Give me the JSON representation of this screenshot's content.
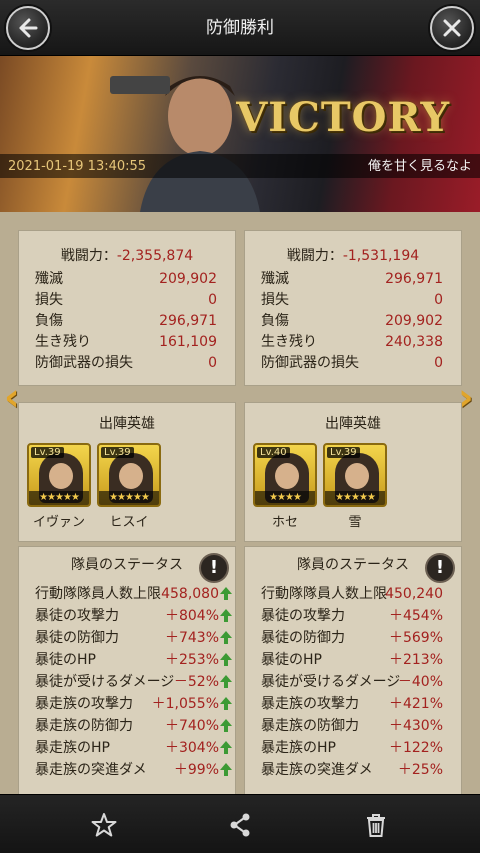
{
  "header": {
    "title": "防御勝利",
    "back_icon": "back-arrow-icon",
    "close_icon": "close-icon"
  },
  "banner": {
    "victory_text": "VICTORY",
    "date": "2021-01-19  13:40:55",
    "quote": "俺を甘く見るなよ"
  },
  "left": {
    "power_label": "戦闘力：",
    "power_value": "-2,355,874",
    "stats": [
      {
        "label": "殲滅",
        "value": "209,902"
      },
      {
        "label": "損失",
        "value": "0"
      },
      {
        "label": "負傷",
        "value": "296,971"
      },
      {
        "label": "生き残り",
        "value": "161,109"
      },
      {
        "label": "防御武器の損失",
        "value": "0"
      }
    ],
    "heroes_title": "出陣英雄",
    "heroes": [
      {
        "level": "Lv.39",
        "name": "イヴァン",
        "stars": "★★★★★"
      },
      {
        "level": "Lv.39",
        "name": "ヒスイ",
        "stars": "★★★★★"
      }
    ],
    "status_title": "隊員のステータス",
    "status": [
      {
        "label": "行動隊隊員人数上限",
        "value": "458,080"
      },
      {
        "label": "暴徒の攻撃力",
        "value": "＋804%"
      },
      {
        "label": "暴徒の防御力",
        "value": "＋743%"
      },
      {
        "label": "暴徒のHP",
        "value": "＋253%"
      },
      {
        "label": "暴徒が受けるダメージ",
        "value": "－52%"
      },
      {
        "label": "暴走族の攻撃力",
        "value": "＋1,055%"
      },
      {
        "label": "暴走族の防御力",
        "value": "＋740%"
      },
      {
        "label": "暴走族のHP",
        "value": "＋304%"
      },
      {
        "label": "暴走族の突進ダメ",
        "value": "＋99%"
      }
    ]
  },
  "right": {
    "power_label": "戦闘力：",
    "power_value": "-1,531,194",
    "stats": [
      {
        "label": "殲滅",
        "value": "296,971"
      },
      {
        "label": "損失",
        "value": "0"
      },
      {
        "label": "負傷",
        "value": "209,902"
      },
      {
        "label": "生き残り",
        "value": "240,338"
      },
      {
        "label": "防御武器の損失",
        "value": "0"
      }
    ],
    "heroes_title": "出陣英雄",
    "heroes": [
      {
        "level": "Lv.40",
        "name": "ホセ",
        "stars": "★★★★"
      },
      {
        "level": "Lv.39",
        "name": "雪",
        "stars": "★★★★★"
      }
    ],
    "status_title": "隊員のステータス",
    "status": [
      {
        "label": "行動隊隊員人数上限",
        "value": "450,240"
      },
      {
        "label": "暴徒の攻撃力",
        "value": "＋454%"
      },
      {
        "label": "暴徒の防御力",
        "value": "＋569%"
      },
      {
        "label": "暴徒のHP",
        "value": "＋213%"
      },
      {
        "label": "暴徒が受けるダメージ",
        "value": "－40%"
      },
      {
        "label": "暴走族の攻撃力",
        "value": "＋421%"
      },
      {
        "label": "暴走族の防御力",
        "value": "＋430%"
      },
      {
        "label": "暴走族のHP",
        "value": "＋122%"
      },
      {
        "label": "暴走族の突進ダメ",
        "value": "＋25%"
      }
    ]
  },
  "bottom": {
    "icons": [
      "star-icon",
      "share-icon",
      "trash-icon"
    ]
  }
}
